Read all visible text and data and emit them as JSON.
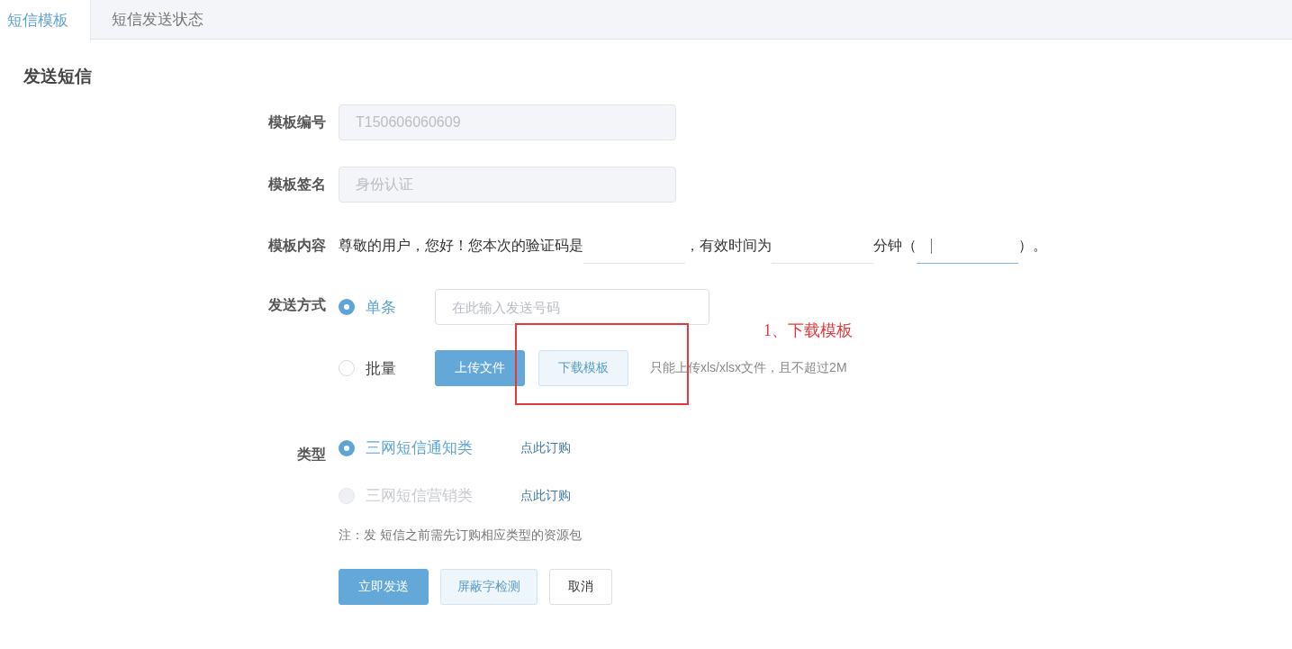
{
  "tabs": [
    {
      "label": "短信模板",
      "selected": true
    },
    {
      "label": "短信发送状态",
      "selected": false
    }
  ],
  "section_title": "发送短信",
  "template_id": {
    "label": "模板编号",
    "placeholder": "T150606060609"
  },
  "template_signature": {
    "label": "模板签名",
    "placeholder": "身份认证"
  },
  "template_content": {
    "label": "模板内容",
    "parts": [
      {
        "kind": "text",
        "text": "尊敬的用户，您好！您本次的验证码是"
      },
      {
        "kind": "blank",
        "focused": false
      },
      {
        "kind": "text",
        "text": "，有效时间为"
      },
      {
        "kind": "blank",
        "focused": false
      },
      {
        "kind": "text",
        "text": "分钟（"
      },
      {
        "kind": "blank",
        "focused": true
      },
      {
        "kind": "text",
        "text": "）。"
      }
    ]
  },
  "send_method": {
    "label": "发送方式",
    "options": [
      {
        "label": "单条",
        "selected": true
      },
      {
        "label": "批量",
        "selected": false
      }
    ],
    "number_field": {
      "placeholder": "在此输入发送号码"
    },
    "upload_button": "上传文件",
    "download_button": "下载模板",
    "upload_hint": "只能上传xls/xlsx文件，且不超过2M"
  },
  "annotation": {
    "text": "1、下载模板"
  },
  "type": {
    "label": "类型",
    "options": [
      {
        "label": "三网短信通知类",
        "selected": true,
        "disabled": false,
        "link": "点此订购"
      },
      {
        "label": "三网短信营销类",
        "selected": false,
        "disabled": true,
        "link": "点此订购"
      }
    ]
  },
  "note": "注：发 短信之前需先订购相应类型的资源包",
  "buttons": [
    {
      "label": "立即发送",
      "kind": "primary"
    },
    {
      "label": "屏蔽字检测",
      "kind": "light"
    },
    {
      "label": "取消",
      "kind": "plain"
    }
  ]
}
